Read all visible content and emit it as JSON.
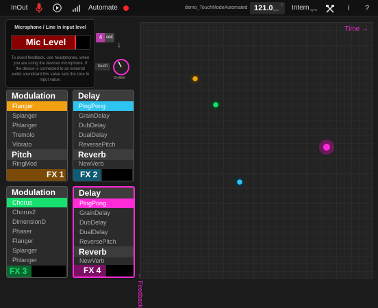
{
  "topbar": {
    "inout": "InOut",
    "automate": "Automate",
    "session": "demo_TouchModeAutomated",
    "bpm": "121.0",
    "bpm_unit": "bpm",
    "bar": "2",
    "sync": "Intern",
    "sync_sub": "sync",
    "info": "i",
    "help": "?"
  },
  "mic_popup": {
    "title": "Microphone / Line In input level",
    "level_label": "Mic Level",
    "help": "To avoid feedback, use headphones, when you are using the devices microphone. If the device is connected to an external audio soundcard this value sets the Line In input value.",
    "channel": "4",
    "out": "out",
    "touch": "touch",
    "drywet": "DryWet"
  },
  "fx1": {
    "modulation": "Modulation",
    "items": [
      "Flanger",
      "Splanger",
      "Phlanger",
      "Tremolo",
      "Vibrato"
    ],
    "pitch": "Pitch",
    "pitch_items": [
      "RingMod"
    ],
    "label": "FX 1"
  },
  "fx2": {
    "delay": "Delay",
    "items": [
      "PingPong",
      "GrainDelay",
      "DubDelay",
      "DualDelay",
      "ReversePitch"
    ],
    "reverb": "Reverb",
    "reverb_items": [
      "NewVerb"
    ],
    "label": "FX 2"
  },
  "fx3": {
    "modulation": "Modulation",
    "items": [
      "Chorus",
      "Chorus2",
      "DimensionD",
      "Phaser",
      "Flanger",
      "Splanger",
      "Phlanger"
    ],
    "label": "FX 3"
  },
  "fx4": {
    "delay": "Delay",
    "items": [
      "PingPong",
      "GrainDelay",
      "DubDelay",
      "DualDelay",
      "ReversePitch"
    ],
    "reverb": "Reverb",
    "reverb_items": [
      "NewVerb"
    ],
    "label": "FX 4"
  },
  "pad": {
    "x_axis": "Time",
    "y_axis": "Feedback"
  },
  "colors": {
    "orange": "#f0a010",
    "cyan": "#2ec4f0",
    "green": "#16e070",
    "pink": "#ff2bd6",
    "record": "#ff2020",
    "mic": "#e03030"
  }
}
